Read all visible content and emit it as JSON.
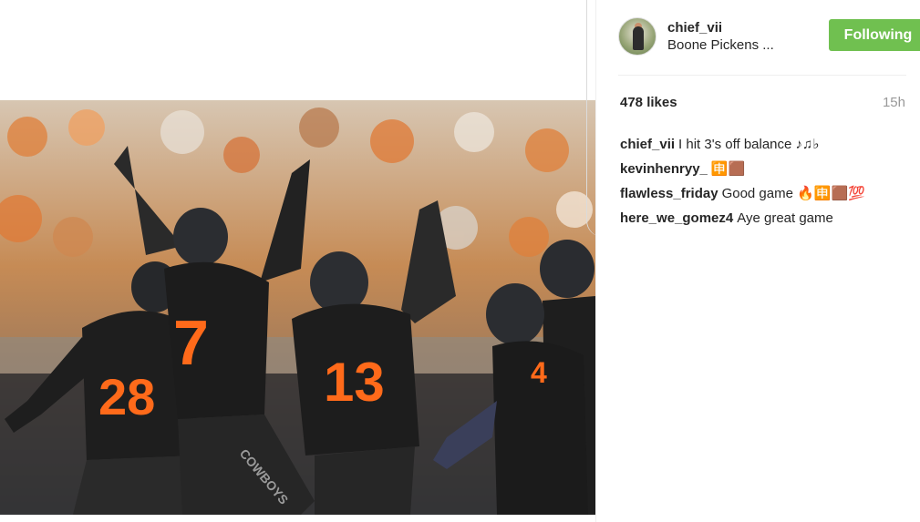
{
  "post": {
    "username": "chief_vii",
    "location": "Boone Pickens ...",
    "follow_label": "Following",
    "likes": "478 likes",
    "time": "15h"
  },
  "comments": [
    {
      "author": "chief_vii",
      "text": "I hit 3's off balance ♪♫♭"
    },
    {
      "author": "kevinhenryy_",
      "text": "🈸🟫"
    },
    {
      "author": "flawless_friday",
      "text": "Good game 🔥🈸🟫💯"
    },
    {
      "author": "here_we_gomez4",
      "text": "Aye great game"
    }
  ],
  "jerseys": {
    "left": "28",
    "center": "7",
    "middle": "13",
    "right": "4",
    "wordmark": "COWBOYS"
  },
  "colors": {
    "follow_green": "#70c050",
    "jersey_black": "#1e1e1e",
    "jersey_orange": "#ff6a1a",
    "crowd_orange": "#e0803a"
  }
}
